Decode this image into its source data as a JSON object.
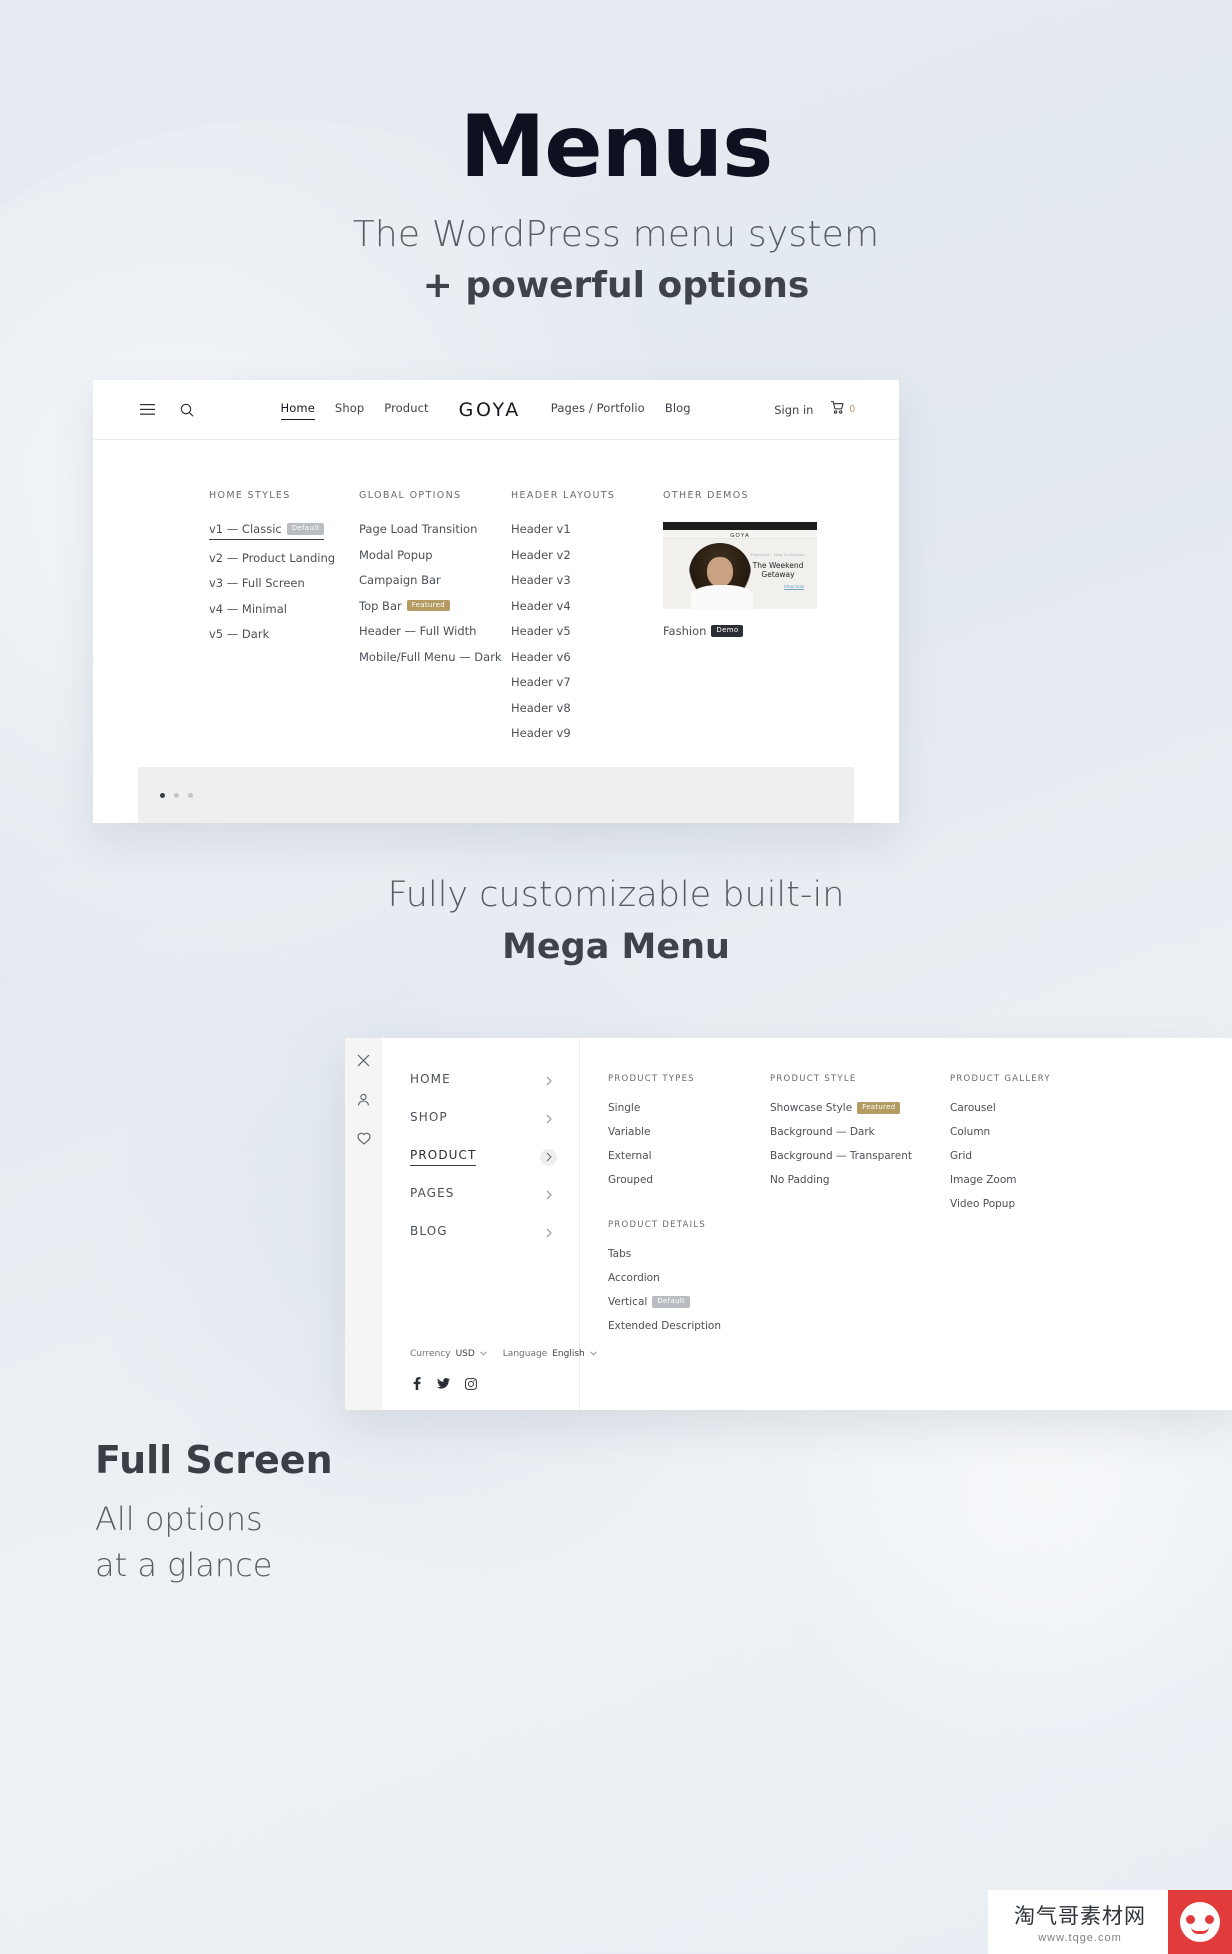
{
  "hero": {
    "title": "Menus",
    "subtitle_1": "The WordPress menu system",
    "subtitle_2": "+ powerful options"
  },
  "mid_heading": {
    "line_1": "Fully customizable built-in",
    "line_2": "Mega Menu"
  },
  "full_screen_heading": {
    "title": "Full Screen",
    "line_1": "All options",
    "line_2": "at a glance"
  },
  "menu_card": {
    "nav": {
      "hamburger_icon": "hamburger-icon",
      "search_icon": "search-icon",
      "links_left": [
        {
          "label": "Home",
          "active": true
        },
        {
          "label": "Shop",
          "active": false
        },
        {
          "label": "Product",
          "active": false
        }
      ],
      "brand": "GOYA",
      "links_right": [
        {
          "label": "Pages / Portfolio",
          "active": false
        },
        {
          "label": "Blog",
          "active": false
        }
      ],
      "sign_in": "Sign in",
      "cart_icon": "cart-icon",
      "cart_count": "0"
    },
    "columns": [
      {
        "title": "HOME STYLES",
        "items": [
          {
            "label": "v1 — Classic",
            "badge": "Default",
            "badge_type": "default",
            "underlined": true
          },
          {
            "label": "v2 — Product Landing"
          },
          {
            "label": "v3 — Full Screen"
          },
          {
            "label": "v4 — Minimal"
          },
          {
            "label": "v5 — Dark"
          }
        ]
      },
      {
        "title": "GLOBAL OPTIONS",
        "items": [
          {
            "label": "Page Load Transition"
          },
          {
            "label": "Modal Popup"
          },
          {
            "label": "Campaign Bar"
          },
          {
            "label": "Top Bar",
            "badge": "Featured",
            "badge_type": "featured"
          },
          {
            "label": "Header — Full Width"
          },
          {
            "label": "Mobile/Full Menu — Dark"
          }
        ]
      },
      {
        "title": "HEADER LAYOUTS",
        "items": [
          {
            "label": "Header v1"
          },
          {
            "label": "Header v2"
          },
          {
            "label": "Header v3"
          },
          {
            "label": "Header v4"
          },
          {
            "label": "Header v5"
          },
          {
            "label": "Header v6"
          },
          {
            "label": "Header v7"
          },
          {
            "label": "Header v8"
          },
          {
            "label": "Header v9"
          }
        ]
      }
    ],
    "other_demos": {
      "title": "OTHER DEMOS",
      "thumb": {
        "logo": "GOYA",
        "eyebrow": "Featured · New Collection",
        "headline_1": "The Weekend",
        "headline_2": "Getaway",
        "cta": "Shop Now"
      },
      "caption": "Fashion",
      "caption_badge": "Demo",
      "caption_badge_type": "demo"
    },
    "carousel_dots": [
      true,
      false,
      false
    ]
  },
  "full_screen_card": {
    "rail_icons": [
      "close-icon",
      "user-icon",
      "heart-icon"
    ],
    "nav_items": [
      {
        "label": "HOME",
        "active": false
      },
      {
        "label": "SHOP",
        "active": false
      },
      {
        "label": "PRODUCT",
        "active": true
      },
      {
        "label": "PAGES",
        "active": false
      },
      {
        "label": "BLOG",
        "active": false
      }
    ],
    "footer": {
      "currency_label": "Currency",
      "currency_value": "USD",
      "language_label": "Language",
      "language_value": "English",
      "socials": [
        "facebook-icon",
        "twitter-icon",
        "instagram-icon"
      ]
    },
    "panels": [
      {
        "groups": [
          {
            "title": "PRODUCT TYPES",
            "items": [
              {
                "label": "Single"
              },
              {
                "label": "Variable"
              },
              {
                "label": "External"
              },
              {
                "label": "Grouped"
              }
            ]
          },
          {
            "title": "PRODUCT DETAILS",
            "items": [
              {
                "label": "Tabs"
              },
              {
                "label": "Accordion"
              },
              {
                "label": "Vertical",
                "badge": "Default",
                "badge_type": "default"
              },
              {
                "label": "Extended Description"
              }
            ]
          }
        ]
      },
      {
        "groups": [
          {
            "title": "PRODUCT STYLE",
            "items": [
              {
                "label": "Showcase Style",
                "badge": "Featured",
                "badge_type": "featured"
              },
              {
                "label": "Background — Dark"
              },
              {
                "label": "Background — Transparent"
              },
              {
                "label": "No Padding"
              }
            ]
          }
        ]
      },
      {
        "groups": [
          {
            "title": "PRODUCT GALLERY",
            "items": [
              {
                "label": "Carousel"
              },
              {
                "label": "Column"
              },
              {
                "label": "Grid"
              },
              {
                "label": "Image Zoom"
              },
              {
                "label": "Video Popup"
              }
            ]
          }
        ]
      }
    ]
  },
  "watermark": {
    "name": "淘气哥素材网",
    "url": "www.tqge.com"
  },
  "colors": {
    "page_background": "#e7ecf2",
    "heading_dark": "#0d1120",
    "text_body": "#4b5057",
    "badge_default": "#b9bdc2",
    "badge_featured": "#b49b62",
    "badge_demo": "#2b2f35",
    "watermark_red": "#e23b3b"
  }
}
